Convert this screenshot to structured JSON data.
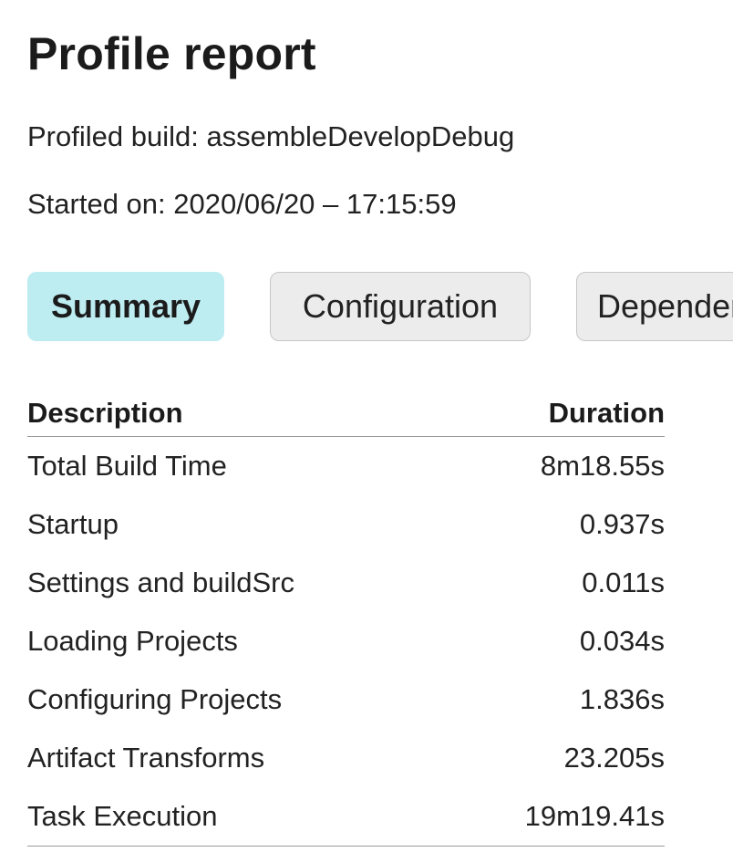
{
  "header": {
    "title": "Profile report",
    "profiled_build": "Profiled build: assembleDevelopDebug",
    "started_on": "Started on: 2020/06/20 – 17:15:59"
  },
  "tabs": [
    {
      "label": "Summary",
      "active": true
    },
    {
      "label": "Configuration",
      "active": false
    },
    {
      "label": "Dependency Resolution",
      "active": false
    }
  ],
  "summary_table": {
    "columns": [
      "Description",
      "Duration"
    ],
    "rows": [
      {
        "description": "Total Build Time",
        "duration": "8m18.55s"
      },
      {
        "description": "Startup",
        "duration": "0.937s"
      },
      {
        "description": "Settings and buildSrc",
        "duration": "0.011s"
      },
      {
        "description": "Loading Projects",
        "duration": "0.034s"
      },
      {
        "description": "Configuring Projects",
        "duration": "1.836s"
      },
      {
        "description": "Artifact Transforms",
        "duration": "23.205s"
      },
      {
        "description": "Task Execution",
        "duration": "19m19.41s"
      }
    ]
  },
  "colors": {
    "active_tab": "#bdecf1",
    "inactive_tab": "#ececec",
    "text": "#1f1f1f",
    "rule": "#9a9a9a"
  }
}
